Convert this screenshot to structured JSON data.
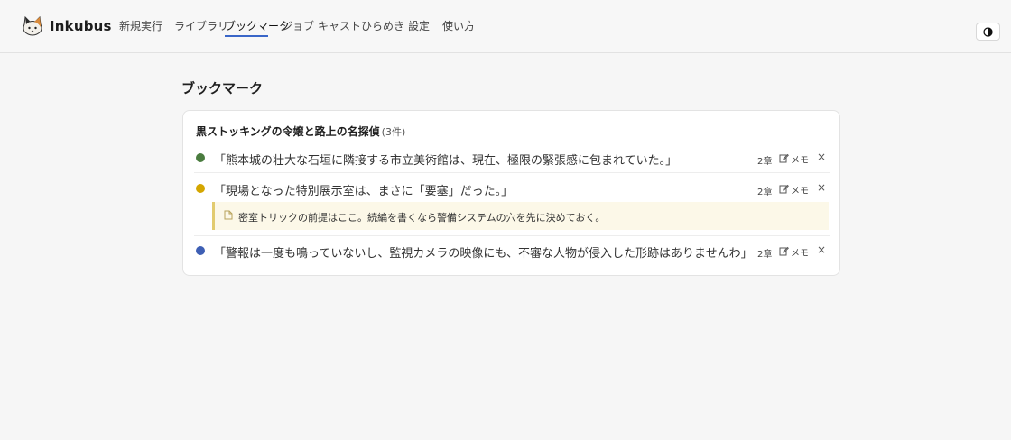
{
  "header": {
    "brand": "Inkubus",
    "nav": [
      {
        "label": "新規実行",
        "active": false
      },
      {
        "label": "ライブラリ",
        "active": false
      },
      {
        "label": "ブックマーク",
        "active": true
      },
      {
        "label": "ジョブ",
        "active": false
      },
      {
        "label": "キャスト",
        "active": false
      },
      {
        "label": "ひらめき",
        "active": false
      },
      {
        "label": "設定",
        "active": false
      },
      {
        "label": "使い方",
        "active": false
      }
    ],
    "theme_icon": "contrast-icon"
  },
  "page": {
    "title": "ブックマーク"
  },
  "card": {
    "title": "黒ストッキングの令嬢と路上の名探偵",
    "count": "(3件)",
    "items": [
      {
        "color": "#4a7c3f",
        "text": "「熊本城の壮大な石垣に隣接する市立美術館は、現在、極限の緊張感に包まれていた。」",
        "episode": "2章",
        "memo_label": "メモ",
        "close": "×"
      },
      {
        "color": "#d4a600",
        "text": "「現場となった特別展示室は、まさに「要塞」だった。」",
        "episode": "2章",
        "memo_label": "メモ",
        "close": "×",
        "note": "密室トリックの前提はここ。続編を書くなら警備システムの穴を先に決めておく。"
      },
      {
        "color": "#3e5fb4",
        "text": "「警報は一度も鳴っていないし、監視カメラの映像にも、不審な人物が侵入した形跡はありませんわ」",
        "episode": "2章",
        "memo_label": "メモ",
        "close": "×"
      }
    ]
  }
}
